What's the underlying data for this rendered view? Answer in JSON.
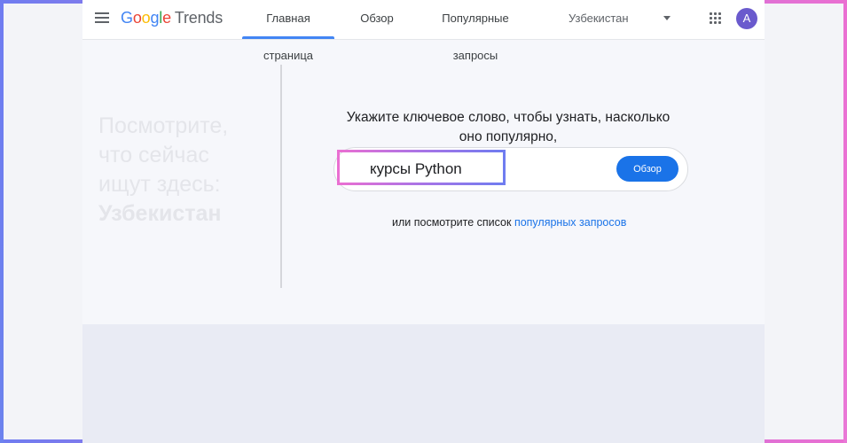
{
  "header": {
    "logo_google": [
      "G",
      "o",
      "o",
      "g",
      "l",
      "e"
    ],
    "logo_trends": "Trends",
    "tabs": [
      {
        "label": "Главная страница",
        "active": true
      },
      {
        "label": "Обзор",
        "active": false
      },
      {
        "label": "Популярные запросы",
        "active": false
      }
    ],
    "region": "Узбекистан",
    "avatar_letter": "A"
  },
  "hero": {
    "line1": "Посмотрите,",
    "line2": "что сейчас",
    "line3": "ищут здесь:",
    "region_name": "Узбекистан"
  },
  "search": {
    "prompt_line1": "Укажите ключевое слово, чтобы узнать, насколько",
    "prompt_line2": "оно популярно,",
    "value": "курсы Python",
    "button_label": "Обзор"
  },
  "footer_link": {
    "prefix": "или посмотрите список ",
    "link_text": "популярных запросов"
  },
  "colors": {
    "accent": "#1a73e8",
    "frame_left": "#6f7cf0",
    "frame_right": "#ea6fd2"
  },
  "icons": [
    "menu-icon",
    "apps-grid-icon",
    "dropdown-caret-icon"
  ]
}
